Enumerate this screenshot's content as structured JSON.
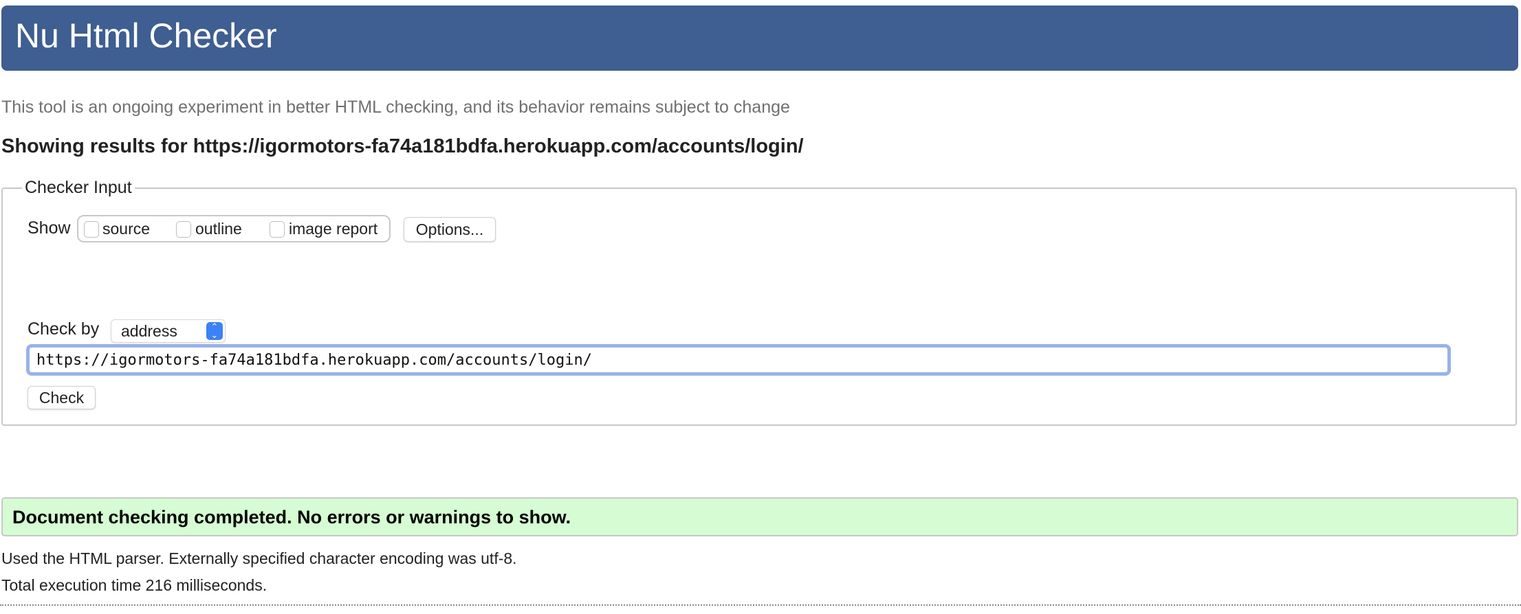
{
  "header": {
    "title": "Nu Html Checker"
  },
  "tagline": "This tool is an ongoing experiment in better HTML checking, and its behavior remains subject to change",
  "results_heading": "Showing results for https://igormotors-fa74a181bdfa.herokuapp.com/accounts/login/",
  "checker_input": {
    "legend": "Checker Input",
    "show_label": "Show",
    "show_options": [
      {
        "label": "source",
        "checked": false
      },
      {
        "label": "outline",
        "checked": false
      },
      {
        "label": "image report",
        "checked": false
      }
    ],
    "options_button": "Options...",
    "check_by_label": "Check by",
    "check_by_value": "address",
    "url_value": "https://igormotors-fa74a181bdfa.herokuapp.com/accounts/login/",
    "check_button": "Check"
  },
  "result": {
    "message": "Document checking completed. No errors or warnings to show.",
    "parser_info": "Used the HTML parser. Externally specified character encoding was utf-8.",
    "execution_time": "Total execution time 216 milliseconds."
  },
  "colors": {
    "header": "#3f5e91",
    "success_bg": "#d6fcd3",
    "focus_ring": "#98b2ea",
    "select_accent": "#3b82f6"
  }
}
